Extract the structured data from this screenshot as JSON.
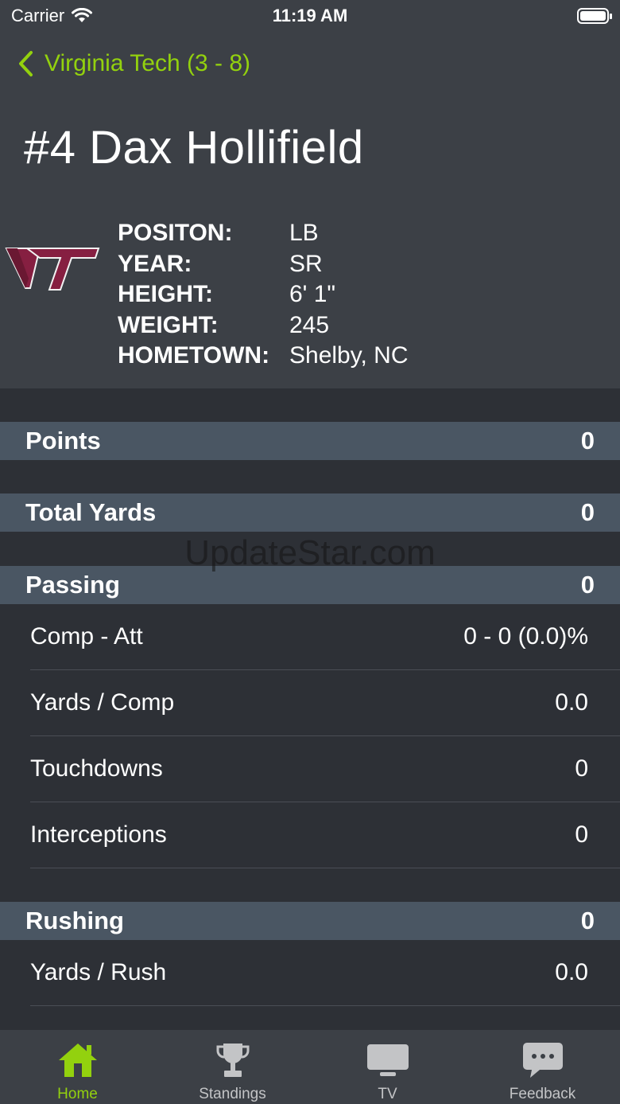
{
  "status_bar": {
    "carrier": "Carrier",
    "time": "11:19 AM"
  },
  "nav": {
    "back_label": "Virginia Tech (3 - 8)"
  },
  "player": {
    "title": "#4 Dax Hollifield",
    "logo_text": "VT",
    "info": [
      {
        "label": "POSITON:",
        "value": "LB"
      },
      {
        "label": "YEAR:",
        "value": "SR"
      },
      {
        "label": "HEIGHT:",
        "value": "6' 1\""
      },
      {
        "label": "WEIGHT:",
        "value": "245"
      },
      {
        "label": "HOMETOWN:",
        "value": "Shelby, NC"
      }
    ]
  },
  "sections": {
    "points": {
      "label": "Points",
      "value": "0"
    },
    "total_yards": {
      "label": "Total Yards",
      "value": "0"
    },
    "passing": {
      "label": "Passing",
      "value": "0",
      "rows": [
        {
          "label": "Comp - Att",
          "value": "0 - 0 (0.0)%"
        },
        {
          "label": "Yards / Comp",
          "value": "0.0"
        },
        {
          "label": "Touchdowns",
          "value": "0"
        },
        {
          "label": "Interceptions",
          "value": "0"
        }
      ]
    },
    "rushing": {
      "label": "Rushing",
      "value": "0",
      "rows": [
        {
          "label": "Yards / Rush",
          "value": "0.0"
        }
      ]
    }
  },
  "watermark": "UpdateStar.com",
  "tabs": [
    {
      "label": "Home",
      "icon": "home-icon",
      "active": true
    },
    {
      "label": "Standings",
      "icon": "trophy-icon",
      "active": false
    },
    {
      "label": "TV",
      "icon": "tv-icon",
      "active": false
    },
    {
      "label": "Feedback",
      "icon": "chat-bubble-icon",
      "active": false
    }
  ],
  "colors": {
    "accent": "#93d10e",
    "background": "#2d3036",
    "header_bg": "#3c4046",
    "section_bg": "#4a5663",
    "vt_maroon": "#861f41"
  }
}
